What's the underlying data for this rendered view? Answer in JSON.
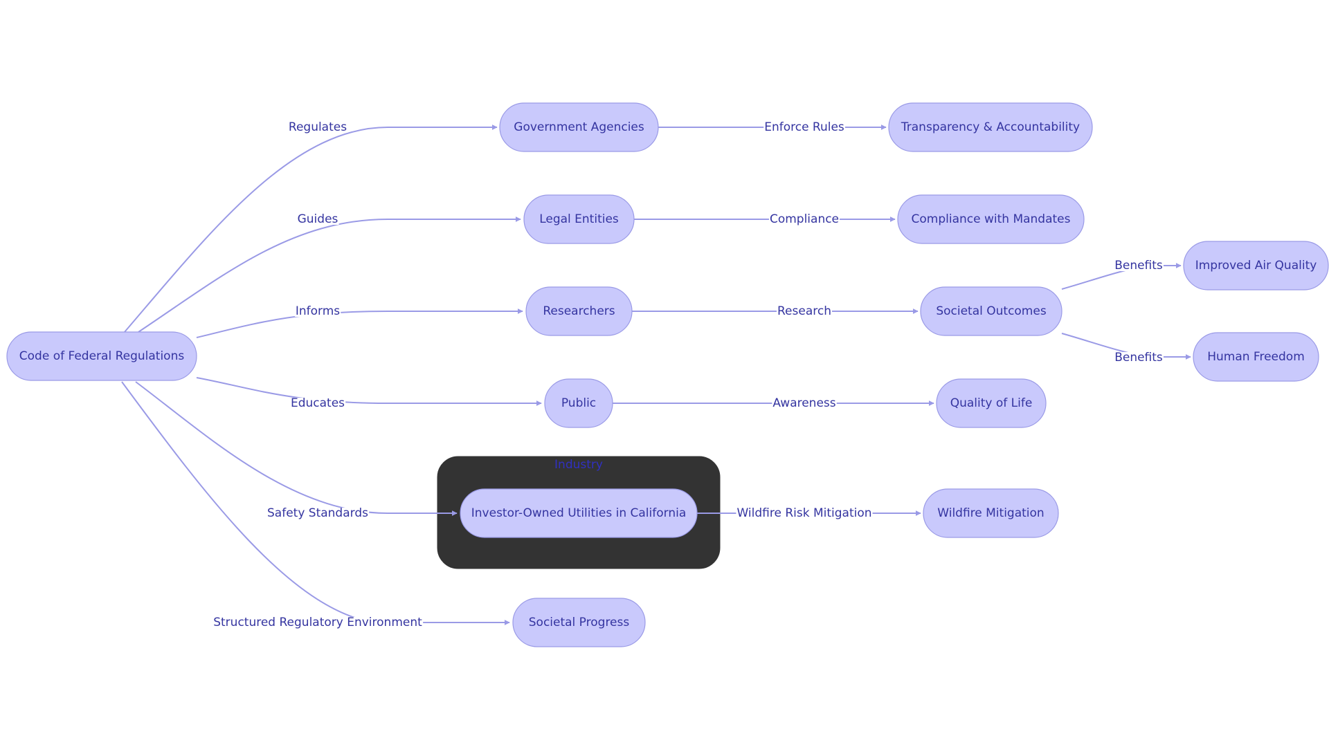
{
  "colors": {
    "node_fill": "#c9c9fc",
    "node_border": "#9a9ae6",
    "edge": "#9a9ae6",
    "text": "#3434a0",
    "cluster_fill": "#333333",
    "cluster_label": "#3030c0",
    "background": "#ffffff"
  },
  "cluster": {
    "id": "industry",
    "label": "Industry"
  },
  "nodes": {
    "cfr": "Code of Federal Regulations",
    "gov": "Government Agencies",
    "trans": "Transparency & Accountability",
    "legal": "Legal Entities",
    "compl": "Compliance with Mandates",
    "res": "Researchers",
    "socout": "Societal Outcomes",
    "iaq": "Improved Air Quality",
    "hf": "Human Freedom",
    "public": "Public",
    "qol": "Quality of Life",
    "iou": "Investor-Owned Utilities in California",
    "wm": "Wildfire Mitigation",
    "sp": "Societal Progress"
  },
  "edges": [
    {
      "from": "cfr",
      "to": "gov",
      "label": "Regulates"
    },
    {
      "from": "cfr",
      "to": "legal",
      "label": "Guides"
    },
    {
      "from": "cfr",
      "to": "res",
      "label": "Informs"
    },
    {
      "from": "cfr",
      "to": "public",
      "label": "Educates"
    },
    {
      "from": "cfr",
      "to": "iou",
      "label": "Safety Standards"
    },
    {
      "from": "cfr",
      "to": "sp",
      "label": "Structured Regulatory Environment"
    },
    {
      "from": "gov",
      "to": "trans",
      "label": "Enforce Rules"
    },
    {
      "from": "legal",
      "to": "compl",
      "label": "Compliance"
    },
    {
      "from": "res",
      "to": "socout",
      "label": "Research"
    },
    {
      "from": "socout",
      "to": "iaq",
      "label": "Benefits"
    },
    {
      "from": "socout",
      "to": "hf",
      "label": "Benefits"
    },
    {
      "from": "public",
      "to": "qol",
      "label": "Awareness"
    },
    {
      "from": "iou",
      "to": "wm",
      "label": "Wildfire Risk Mitigation"
    }
  ]
}
